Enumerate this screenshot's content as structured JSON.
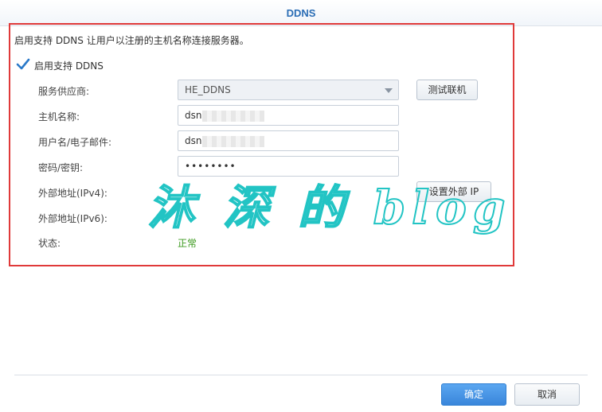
{
  "window": {
    "title": "DDNS"
  },
  "description": "启用支持 DDNS 让用户以注册的主机名称连接服务器。",
  "enable": {
    "label": "启用支持 DDNS",
    "checked": true
  },
  "fields": {
    "provider": {
      "label": "服务供应商:",
      "value": "HE_DDNS"
    },
    "hostname": {
      "label": "主机名称:",
      "value": "dsn"
    },
    "username": {
      "label": "用户名/电子邮件:",
      "value": "dsn"
    },
    "password": {
      "label": "密码/密钥:",
      "value": "••••••••"
    },
    "ipv4": {
      "label": "外部地址(IPv4):"
    },
    "ipv6": {
      "label": "外部地址(IPv6):",
      "value": "-"
    },
    "status": {
      "label": "状态:",
      "value": "正常"
    }
  },
  "buttons": {
    "test": "测试联机",
    "set_external_ip": "设置外部 IP",
    "ok": "确定",
    "cancel": "取消"
  },
  "watermark": "沐 深 的 blog",
  "colors": {
    "accent": "#2a6db5",
    "highlight_border": "#e03a3a",
    "status_ok": "#3c9a1f",
    "primary_button": "#3a86db",
    "watermark": "#22c4c4"
  }
}
